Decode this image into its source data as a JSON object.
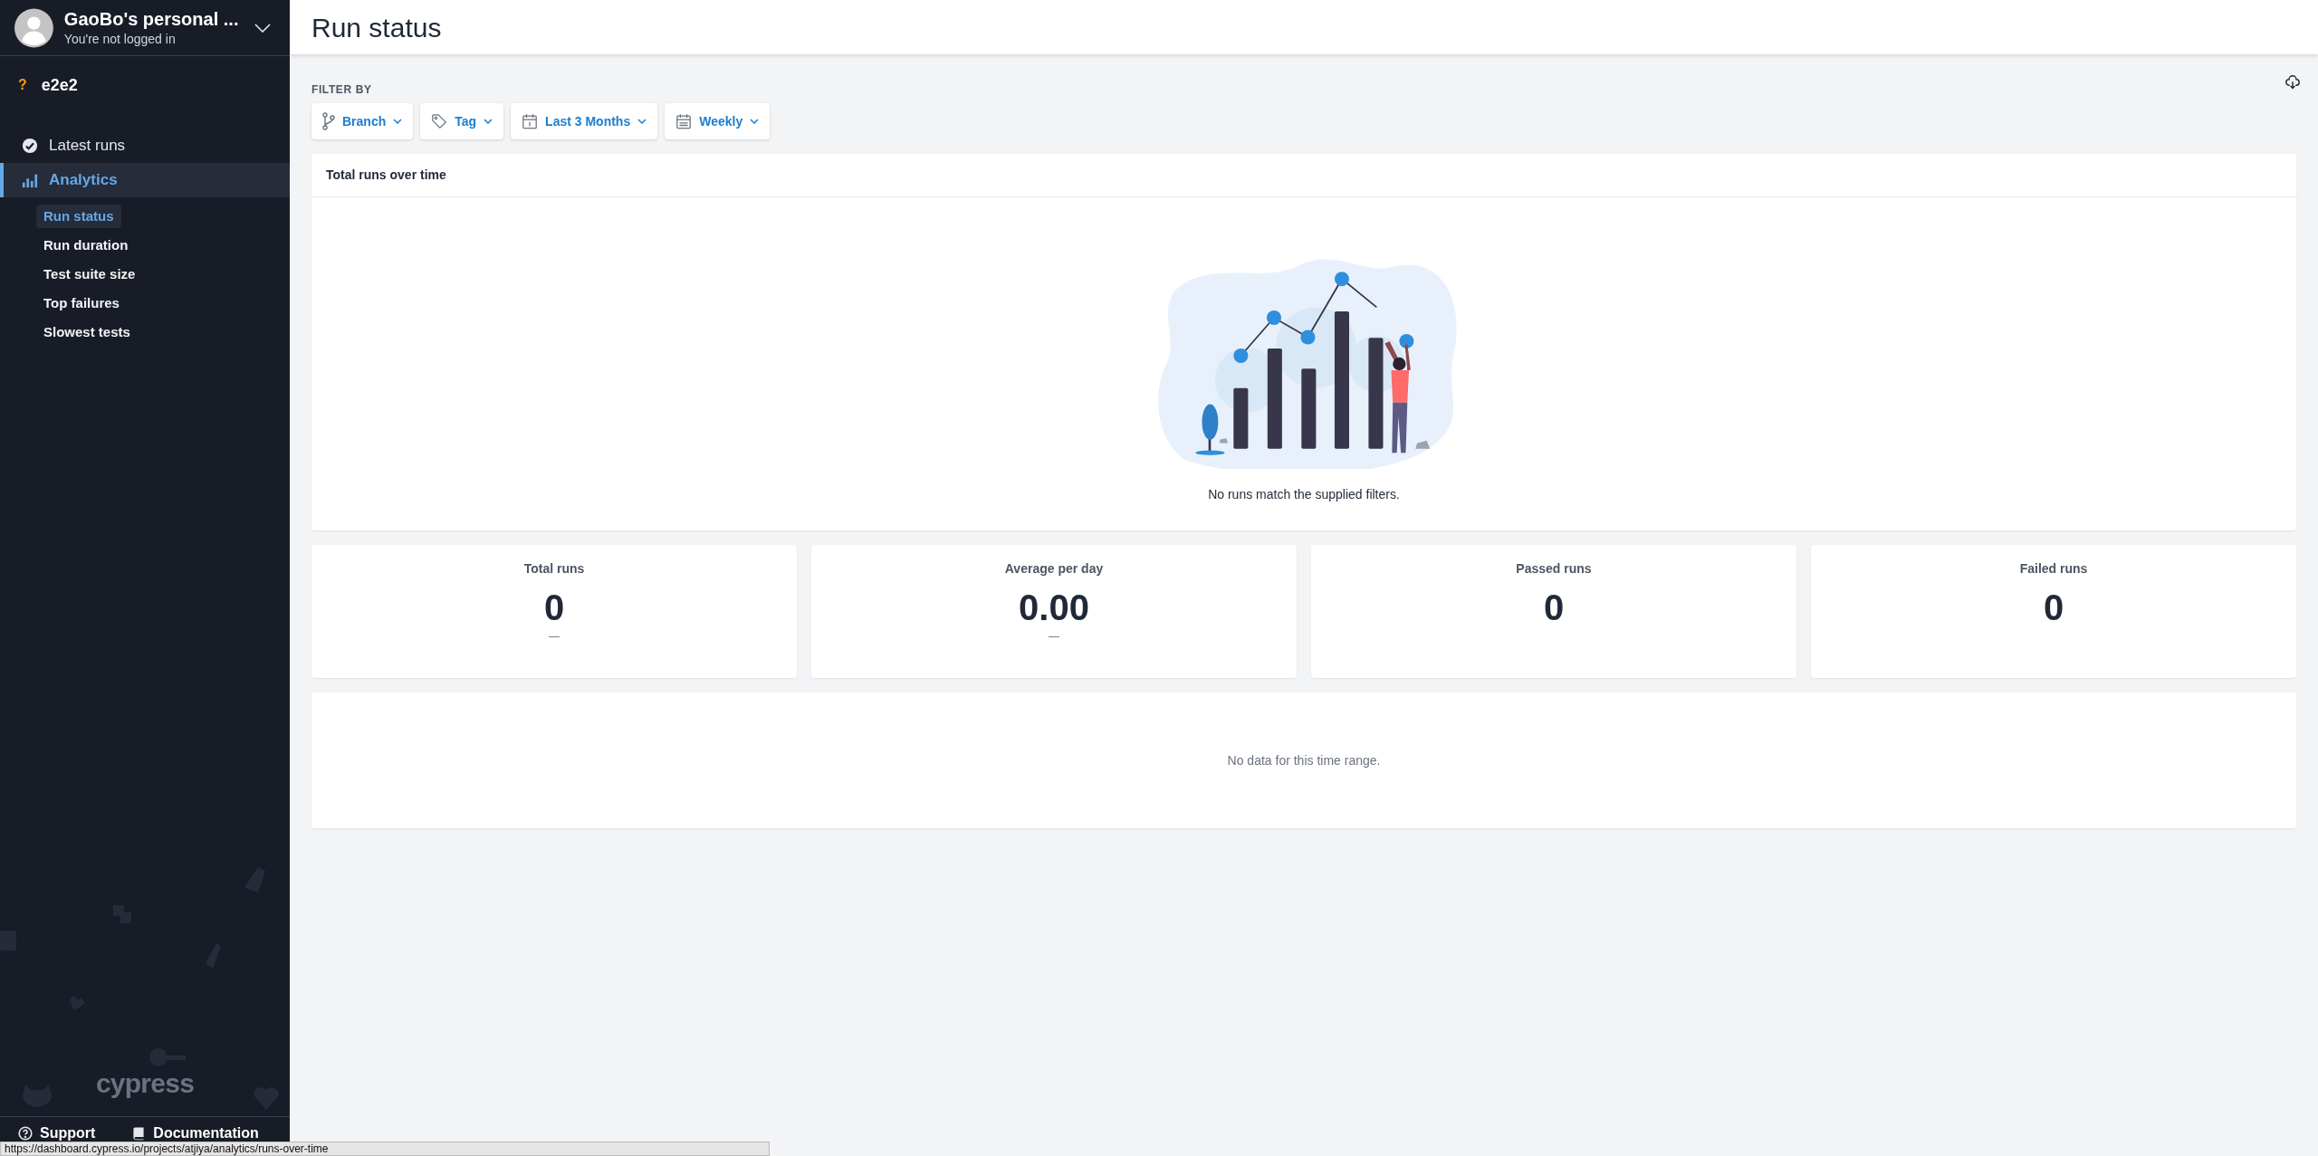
{
  "account": {
    "name": "GaoBo's personal ...",
    "subtitle": "You're not logged in"
  },
  "project": {
    "status_icon": "?",
    "name": "e2e2"
  },
  "nav": [
    {
      "label": "Latest runs",
      "selected": false
    },
    {
      "label": "Analytics",
      "selected": true,
      "children": [
        {
          "label": "Run status",
          "selected": true
        },
        {
          "label": "Run duration",
          "selected": false
        },
        {
          "label": "Test suite size",
          "selected": false
        },
        {
          "label": "Top failures",
          "selected": false
        },
        {
          "label": "Slowest tests",
          "selected": false
        }
      ]
    }
  ],
  "logo": "cypress",
  "footer_links": [
    {
      "label": "Support"
    },
    {
      "label": "Documentation"
    }
  ],
  "status_url": "https://dashboard.cypress.io/projects/atjiya/analytics/runs-over-time",
  "page_title": "Run status",
  "filter_label": "FILTER BY",
  "filters": [
    {
      "label": "Branch"
    },
    {
      "label": "Tag"
    },
    {
      "label": "Last 3 Months"
    },
    {
      "label": "Weekly"
    }
  ],
  "chart_card": {
    "title": "Total runs over time",
    "empty_message": "No runs match the supplied filters."
  },
  "stats": [
    {
      "label": "Total runs",
      "value": "0",
      "trend": "—"
    },
    {
      "label": "Average per day",
      "value": "0.00",
      "trend": "—"
    },
    {
      "label": "Passed runs",
      "value": "0"
    },
    {
      "label": "Failed runs",
      "value": "0"
    }
  ],
  "table_card": {
    "empty_message": "No data for this time range."
  }
}
